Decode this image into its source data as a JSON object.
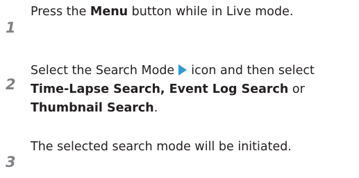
{
  "steps": [
    {
      "number": "1",
      "line1_a": "Press the ",
      "line1_b": "Menu",
      "line1_c": " button while in Live mode."
    },
    {
      "number": "2",
      "line1_a": "Select the Search Mode",
      "line1_icon": "play-triangle-icon",
      "line1_b": "icon and then select",
      "line2_a": "Time-Lapse Search, Event Log Search",
      "line2_b": " or",
      "line3_a": "Thumbnail Search",
      "line3_b": "."
    },
    {
      "number": "3",
      "line1_a": "The selected search mode will be initiated."
    }
  ],
  "colors": {
    "text": "#231f20",
    "step_number": "#808285",
    "icon": "#2e9ad6"
  }
}
